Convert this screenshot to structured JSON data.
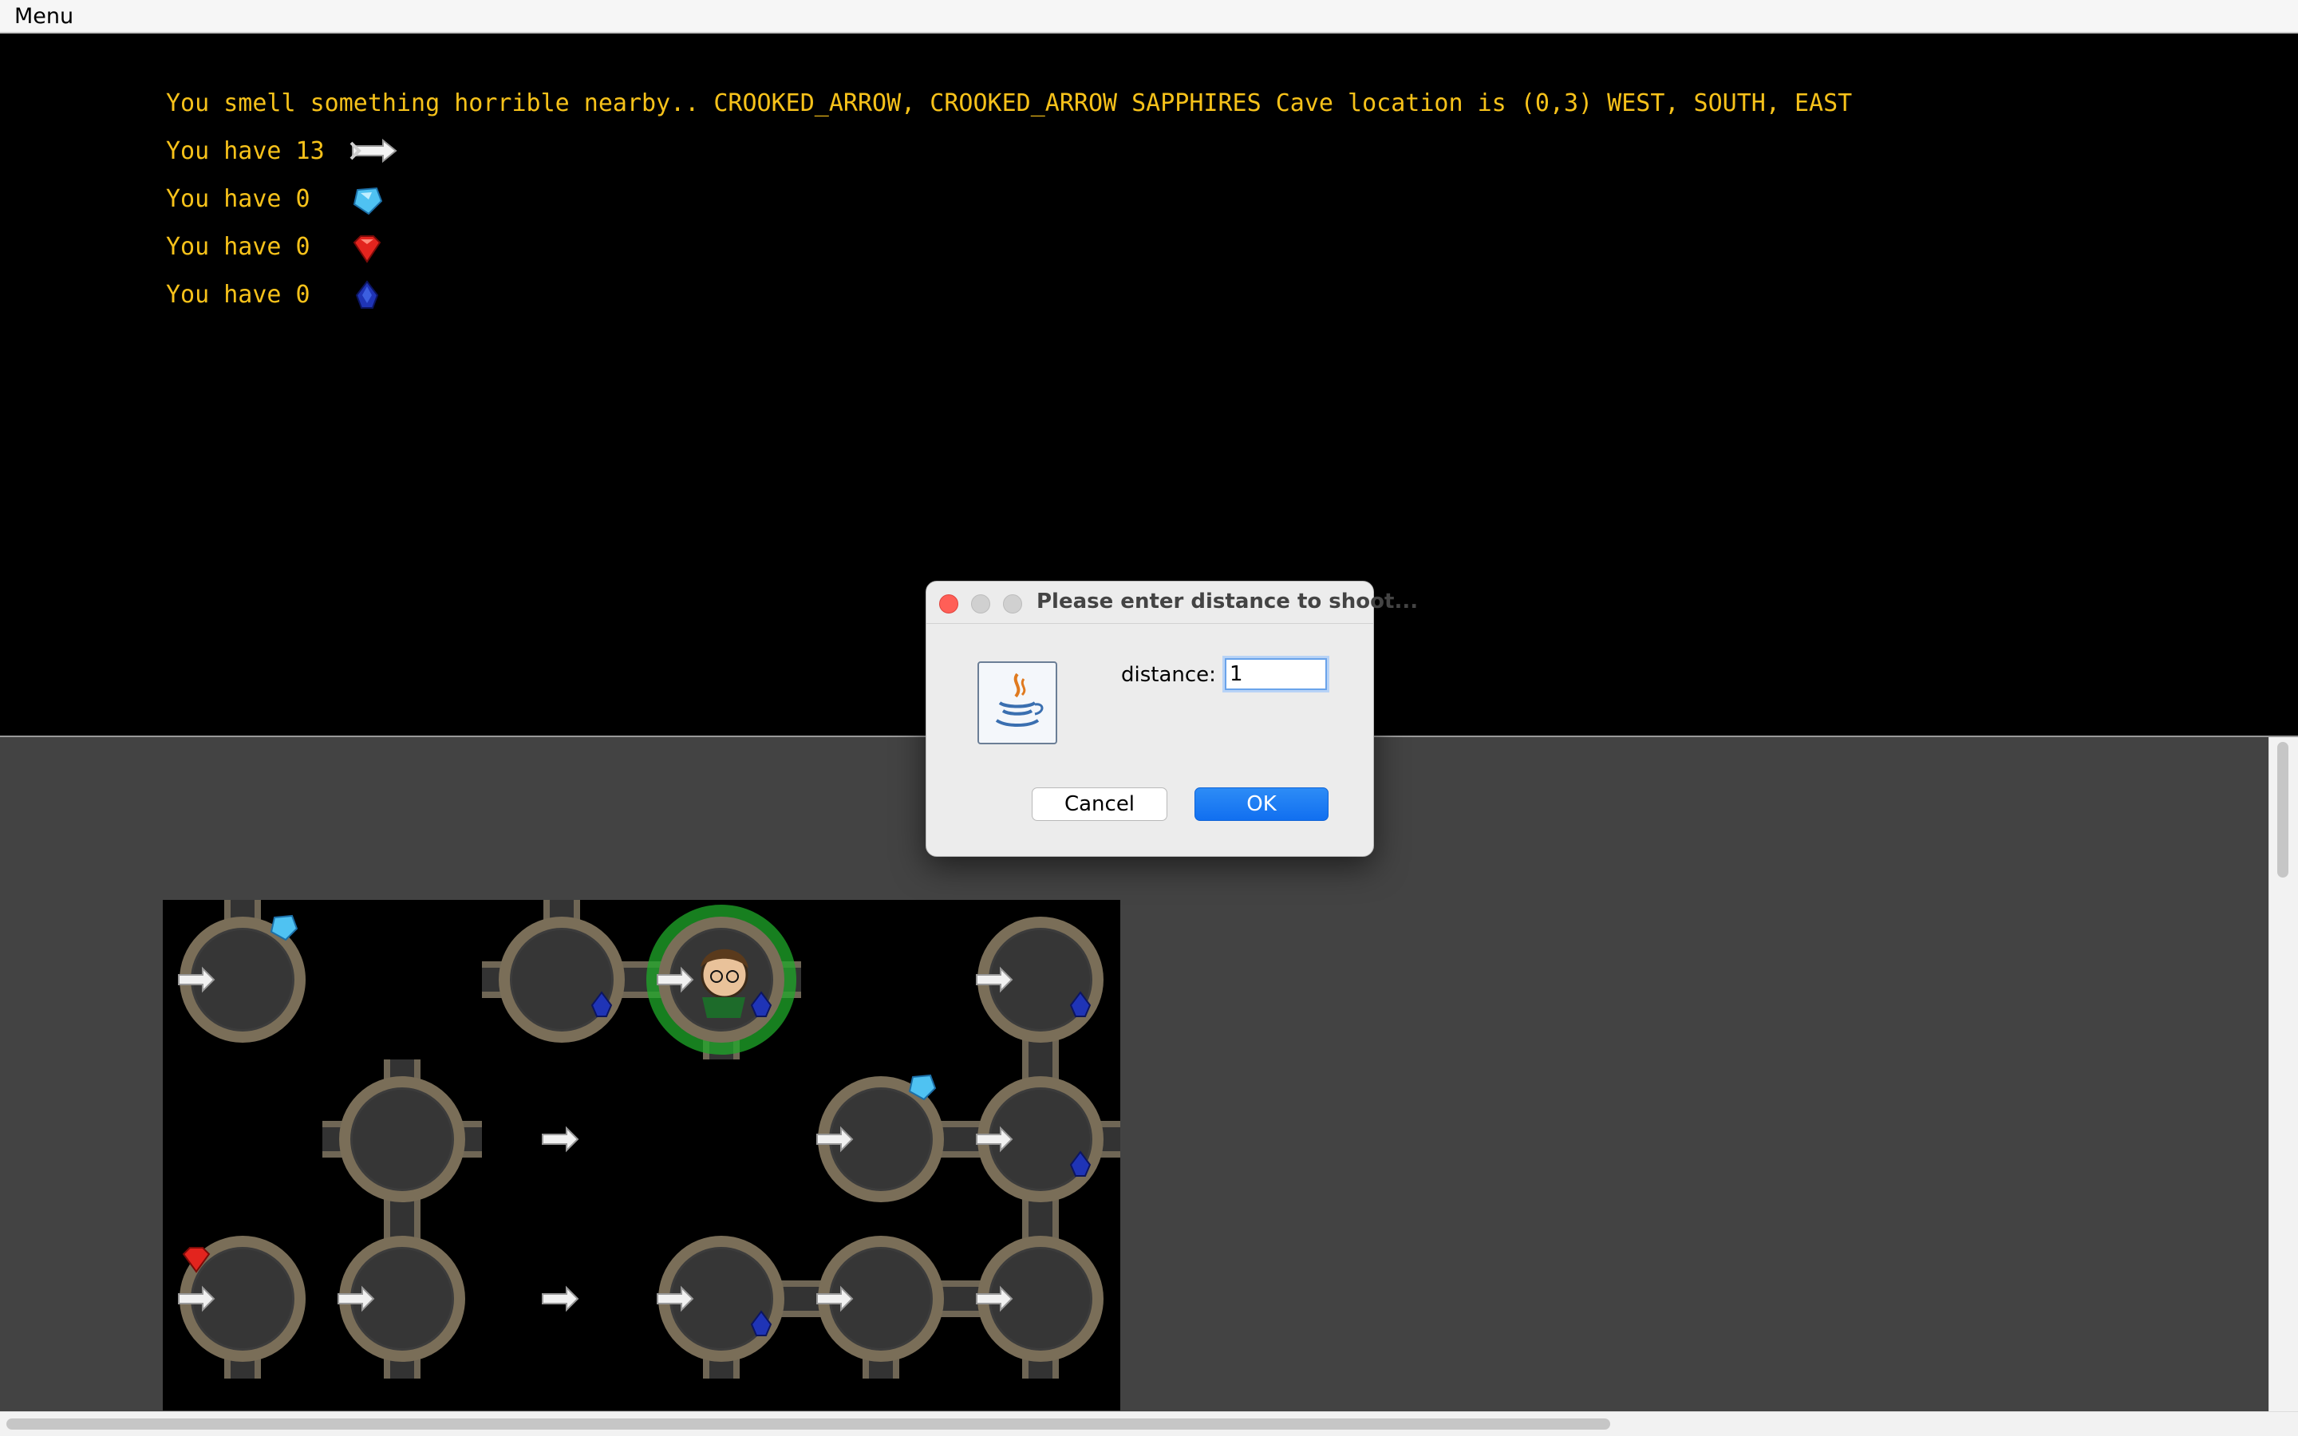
{
  "menubar": {
    "menu_label": "Menu"
  },
  "console": {
    "message": "You smell something horrible nearby.. CROOKED_ARROW, CROOKED_ARROW SAPPHIRES Cave location is (0,3) WEST, SOUTH, EAST",
    "inventory": [
      {
        "text": "You have 13",
        "icon": "arrow-icon"
      },
      {
        "text": "You have 0",
        "icon": "diamond-icon"
      },
      {
        "text": "You have 0",
        "icon": "ruby-icon"
      },
      {
        "text": "You have 0",
        "icon": "sapphire-icon"
      }
    ]
  },
  "dialog": {
    "title": "Please enter distance to shoot...",
    "field_label": "distance:",
    "field_value": "1",
    "cancel_label": "Cancel",
    "ok_label": "OK",
    "icon": "java-icon"
  },
  "map": {
    "caves": [
      {
        "row": 0,
        "col": 0,
        "items": [
          "arrow",
          "diamond"
        ],
        "exits": [
          "N"
        ]
      },
      {
        "row": 0,
        "col": 2,
        "items": [
          "sapphire"
        ],
        "exits": [
          "N",
          "E",
          "W"
        ]
      },
      {
        "row": 0,
        "col": 3,
        "items": [
          "arrow",
          "sapphire"
        ],
        "exits": [
          "W",
          "S",
          "E"
        ],
        "player": true
      },
      {
        "row": 0,
        "col": 5,
        "items": [
          "arrow",
          "sapphire"
        ],
        "exits": [
          "S"
        ]
      },
      {
        "row": 1,
        "col": 1,
        "items": [],
        "exits": [
          "N",
          "S",
          "E",
          "W"
        ]
      },
      {
        "row": 1,
        "col": 4,
        "items": [
          "arrow",
          "diamond"
        ],
        "exits": [
          "E"
        ]
      },
      {
        "row": 1,
        "col": 5,
        "items": [
          "arrow",
          "sapphire"
        ],
        "exits": [
          "N",
          "S",
          "E",
          "W"
        ]
      },
      {
        "row": 2,
        "col": 0,
        "items": [
          "arrow",
          "ruby"
        ],
        "exits": [
          "S"
        ]
      },
      {
        "row": 2,
        "col": 1,
        "items": [
          "arrow"
        ],
        "exits": [
          "N",
          "S"
        ]
      },
      {
        "row": 2,
        "col": 3,
        "items": [
          "arrow",
          "sapphire"
        ],
        "exits": [
          "E",
          "S"
        ]
      },
      {
        "row": 2,
        "col": 4,
        "items": [
          "arrow"
        ],
        "exits": [
          "E",
          "W",
          "S"
        ]
      },
      {
        "row": 2,
        "col": 5,
        "items": [
          "arrow"
        ],
        "exits": [
          "N",
          "W",
          "S"
        ]
      }
    ],
    "loose_arrows": [
      {
        "row": 1,
        "col": 2
      },
      {
        "row": 2,
        "col": 2
      }
    ]
  },
  "colors": {
    "console_text": "#f7c21a",
    "panel_bg": "#434343",
    "ok_button": "#116ff0",
    "player_glow": "#1faa2a"
  }
}
